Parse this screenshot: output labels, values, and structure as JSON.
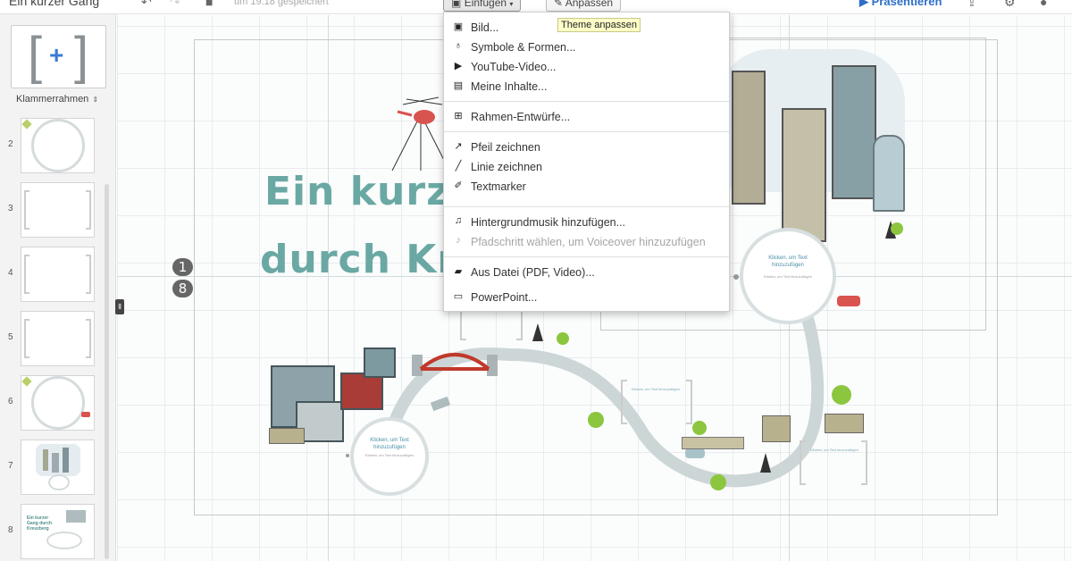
{
  "toolbar": {
    "doc_title": "Ein kurzer Gang",
    "save_status": "um 19:18 gespeichert",
    "insert_label": "Einfügen",
    "customize_label": "Anpassen",
    "present_label": "Präsentieren"
  },
  "sidebar": {
    "frame_type_label": "Klammerrahmen",
    "thumbnails": [
      {
        "num": "2"
      },
      {
        "num": "3"
      },
      {
        "num": "4"
      },
      {
        "num": "5"
      },
      {
        "num": "6"
      },
      {
        "num": "7"
      },
      {
        "num": "8"
      }
    ],
    "thumb8_text": "Ein kurzer Gang durch Kreuzberg"
  },
  "canvas": {
    "title_line1": "Ein kurze",
    "title_line2": "durch Kre",
    "step_badges": [
      "1",
      "8"
    ],
    "circle_title": "Klicken, um Text hinzuzufügen",
    "circle_subtitle": "Klicken, um Text hinzuzufügen",
    "bracket_title": "Klicken, um Text hinzuzufügen"
  },
  "menu": {
    "items": [
      {
        "label": "Bild...",
        "icon": "image-icon",
        "disabled": false
      },
      {
        "label": "Symbole & Formen...",
        "icon": "lightbulb-icon",
        "disabled": false
      },
      {
        "label": "YouTube-Video...",
        "icon": "youtube-icon",
        "disabled": false
      },
      {
        "label": "Meine Inhalte...",
        "icon": "folder-icon",
        "disabled": false
      },
      {
        "label": "Rahmen-Entwürfe...",
        "icon": "frame-plus-icon",
        "disabled": false
      },
      {
        "label": "Pfeil zeichnen",
        "icon": "arrow-icon",
        "disabled": false
      },
      {
        "label": "Linie zeichnen",
        "icon": "line-icon",
        "disabled": false
      },
      {
        "label": "Textmarker",
        "icon": "highlighter-icon",
        "disabled": false
      },
      {
        "label": "Hintergrundmusik hinzufügen...",
        "icon": "music-file-icon",
        "disabled": false
      },
      {
        "label": "Pfadschritt wählen, um Voiceover hinzuzufügen",
        "icon": "music-note-icon",
        "disabled": true
      },
      {
        "label": "Aus Datei (PDF, Video)...",
        "icon": "file-icon",
        "disabled": false
      },
      {
        "label": "PowerPoint...",
        "icon": "powerpoint-icon",
        "disabled": false
      }
    ],
    "tooltip": "Theme anpassen"
  },
  "colors": {
    "accent": "#2d6fc8",
    "title_teal": "#6aa8a4",
    "road": "#cdd6d7"
  }
}
